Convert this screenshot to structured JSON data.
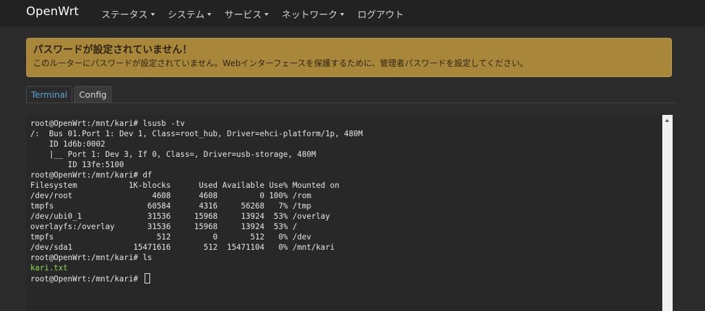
{
  "navbar": {
    "brand": "OpenWrt",
    "menu": [
      {
        "label": "ステータス",
        "dropdown": true
      },
      {
        "label": "システム",
        "dropdown": true
      },
      {
        "label": "サービス",
        "dropdown": true
      },
      {
        "label": "ネットワーク",
        "dropdown": true
      },
      {
        "label": "ログアウト",
        "dropdown": false
      }
    ]
  },
  "alert": {
    "title": "パスワードが設定されていません！",
    "message": "このルーターにパスワードが設定されていません。Webインターフェースを保護するために、管理者パスワードを設定してください。"
  },
  "tabs": [
    {
      "label": "Terminal",
      "active": true
    },
    {
      "label": "Config",
      "active": false
    }
  ],
  "terminal": {
    "lines": [
      {
        "text": "root@OpenWrt:/mnt/kari# lsusb -tv",
        "color": "default"
      },
      {
        "text": "/:  Bus 01.Port 1: Dev 1, Class=root_hub, Driver=ehci-platform/1p, 480M",
        "color": "default"
      },
      {
        "text": "    ID 1d6b:0002",
        "color": "default"
      },
      {
        "text": "    |__ Port 1: Dev 3, If 0, Class=, Driver=usb-storage, 480M",
        "color": "default"
      },
      {
        "text": "        ID 13fe:5100",
        "color": "default"
      },
      {
        "text": "root@OpenWrt:/mnt/kari# df",
        "color": "default"
      },
      {
        "text": "Filesystem           1K-blocks      Used Available Use% Mounted on",
        "color": "default"
      },
      {
        "text": "/dev/root                 4608      4608         0 100% /rom",
        "color": "default"
      },
      {
        "text": "tmpfs                    60584      4316     56268   7% /tmp",
        "color": "default"
      },
      {
        "text": "/dev/ubi0_1              31536     15968     13924  53% /overlay",
        "color": "default"
      },
      {
        "text": "overlayfs:/overlay       31536     15968     13924  53% /",
        "color": "default"
      },
      {
        "text": "tmpfs                      512         0       512   0% /dev",
        "color": "default"
      },
      {
        "text": "/dev/sda1             15471616       512  15471104   0% /mnt/kari",
        "color": "default"
      },
      {
        "text": "root@OpenWrt:/mnt/kari# ls",
        "color": "default"
      },
      {
        "text": "kari.txt",
        "color": "green"
      },
      {
        "text": "root@OpenWrt:/mnt/kari# ",
        "color": "default",
        "cursor": true
      }
    ],
    "colors": {
      "default": "#e6e6e6",
      "green": "#8ee049",
      "background": "#282828"
    }
  },
  "colors": {
    "navbar_bg": "#222222",
    "alert_bg": "#a8873a",
    "tab_active": "#5aa7d6"
  }
}
